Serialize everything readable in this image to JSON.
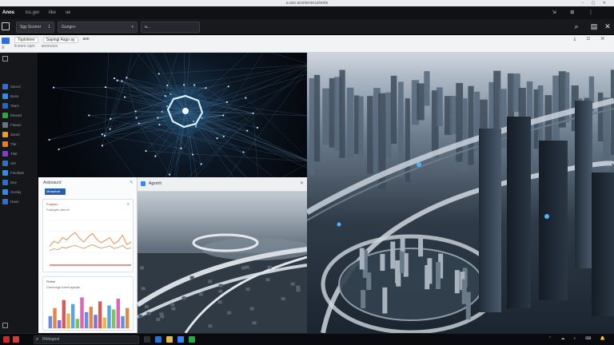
{
  "osbar": {
    "title": "a ass acsmenecucteets",
    "window_controls": "– ▢ ✕"
  },
  "menubar": {
    "app": "Anos",
    "items": [
      "iss.ger",
      "ilke",
      "ue"
    ],
    "tools": "⇲ ⊞ ⋮"
  },
  "toolbar": {
    "field1": "Sgy Scorrer",
    "field1_suffix": "1",
    "field2": "Gungo+",
    "field3": "a..."
  },
  "subbar": {
    "tabs": [
      "Toplotiner",
      "Sapingi Asgo ay"
    ],
    "extra": "ase",
    "row2": [
      "liceere sqm",
      "seroooce"
    ]
  },
  "sidebar": {
    "items": [
      {
        "label": "Sarvel",
        "color": "#2a6fdb"
      },
      {
        "label": "Buse",
        "color": "#3b82f6"
      },
      {
        "label": "Taars",
        "color": "#1e66d0"
      },
      {
        "label": "Eleeatt",
        "color": "#27a745"
      },
      {
        "label": "Flaaus",
        "color": "#6b7280"
      },
      {
        "label": "Sanel",
        "color": "#f59e0b"
      },
      {
        "label": "Tlar",
        "color": "#ef7b19"
      },
      {
        "label": "Tlait",
        "color": "#7c3aed"
      },
      {
        "label": "Sirt",
        "color": "#2f6fd1"
      },
      {
        "label": "Finotlate",
        "color": "#3b82f6"
      },
      {
        "label": "Boe",
        "color": "#2a6fdb"
      },
      {
        "label": "Scelay",
        "color": "#3b82f6"
      },
      {
        "label": "Haan",
        "color": "#2a6fdb"
      }
    ]
  },
  "dashboard": {
    "title": "Aisboaurd",
    "button": "Mnaarbat",
    "card1_title": "Foaalon",
    "card1_sub": "Foslopen lam trt",
    "card2_title": "Flrtlrel",
    "card2_sub": "Cseneogs tueelt agepts"
  },
  "aerial": {
    "label": "Agsrtrlt"
  },
  "taskbar": {
    "search": "Rhtlogest",
    "tray": "⌃ ☁ ◐ ⌨ 🔔"
  },
  "chart_data": [
    {
      "type": "line",
      "title": "",
      "series": [
        {
          "values": [
            40,
            52,
            47,
            60,
            55,
            65,
            72,
            58,
            50,
            62,
            70,
            56,
            48,
            54,
            60,
            46,
            52,
            66,
            44,
            50
          ]
        },
        {
          "values": [
            30,
            34,
            32,
            38,
            36,
            40,
            42,
            38,
            35,
            40,
            44,
            39,
            36,
            38,
            41,
            35,
            37,
            42,
            34,
            36
          ]
        }
      ],
      "ylim": [
        0,
        100
      ]
    },
    {
      "type": "bar",
      "title": "",
      "values": [
        18,
        30,
        12,
        42,
        22,
        36,
        14,
        46,
        24,
        32,
        20,
        40,
        16,
        34,
        28,
        44,
        18,
        30
      ],
      "colors": [
        "#6b8dd6",
        "#e0874d",
        "#8c6bd6",
        "#d65a5a",
        "#e5b84d",
        "#5aa6d6",
        "#7fbf6a",
        "#d66ab0",
        "#6b8dd6",
        "#e0874d",
        "#8c6bd6",
        "#d65a5a",
        "#e5b84d",
        "#5aa6d6",
        "#7fbf6a",
        "#d66ab0",
        "#6b8dd6",
        "#e0874d"
      ],
      "ylim": [
        0,
        50
      ]
    }
  ]
}
